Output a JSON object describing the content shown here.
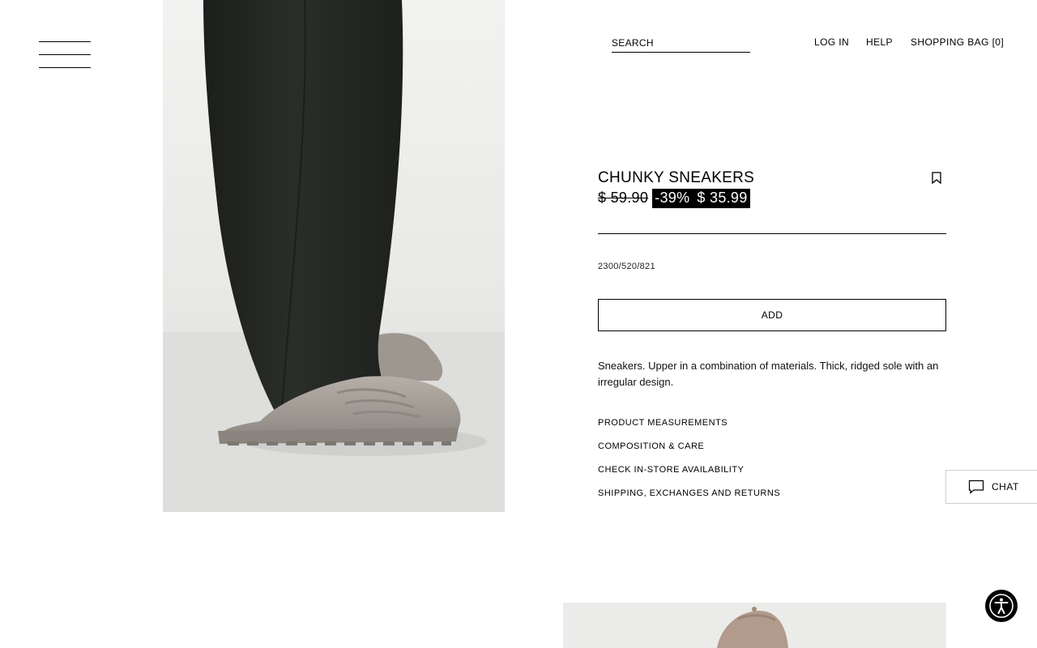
{
  "header": {
    "search_placeholder": "SEARCH",
    "login": "LOG IN",
    "help": "HELP",
    "bag_label": "SHOPPING BAG",
    "bag_count": "[0]"
  },
  "product": {
    "name": "CHUNKY SNEAKERS",
    "old_price": "$ 59.90",
    "discount": "-39%",
    "price": "$ 35.99",
    "reference": "2300/520/821",
    "add_label": "ADD",
    "description": "Sneakers. Upper in a combination of materials. Thick, ridged sole with an irregular design."
  },
  "info_links": [
    "PRODUCT MEASUREMENTS",
    "COMPOSITION & CARE",
    "CHECK IN-STORE AVAILABILITY",
    "SHIPPING, EXCHANGES AND RETURNS"
  ],
  "chat": {
    "label": "CHAT",
    "icon": "chat-bubble-icon"
  },
  "icons": {
    "menu": "hamburger-menu-icon",
    "favorite": "bookmark-icon",
    "accessibility": "accessibility-icon"
  },
  "colors": {
    "background": "#ffffff",
    "text": "#000000",
    "sale_bg": "#000000",
    "sale_text": "#ffffff",
    "photo_wall": "#e8e8e6",
    "trousers": "#262826",
    "sneaker": "#a39d96"
  }
}
